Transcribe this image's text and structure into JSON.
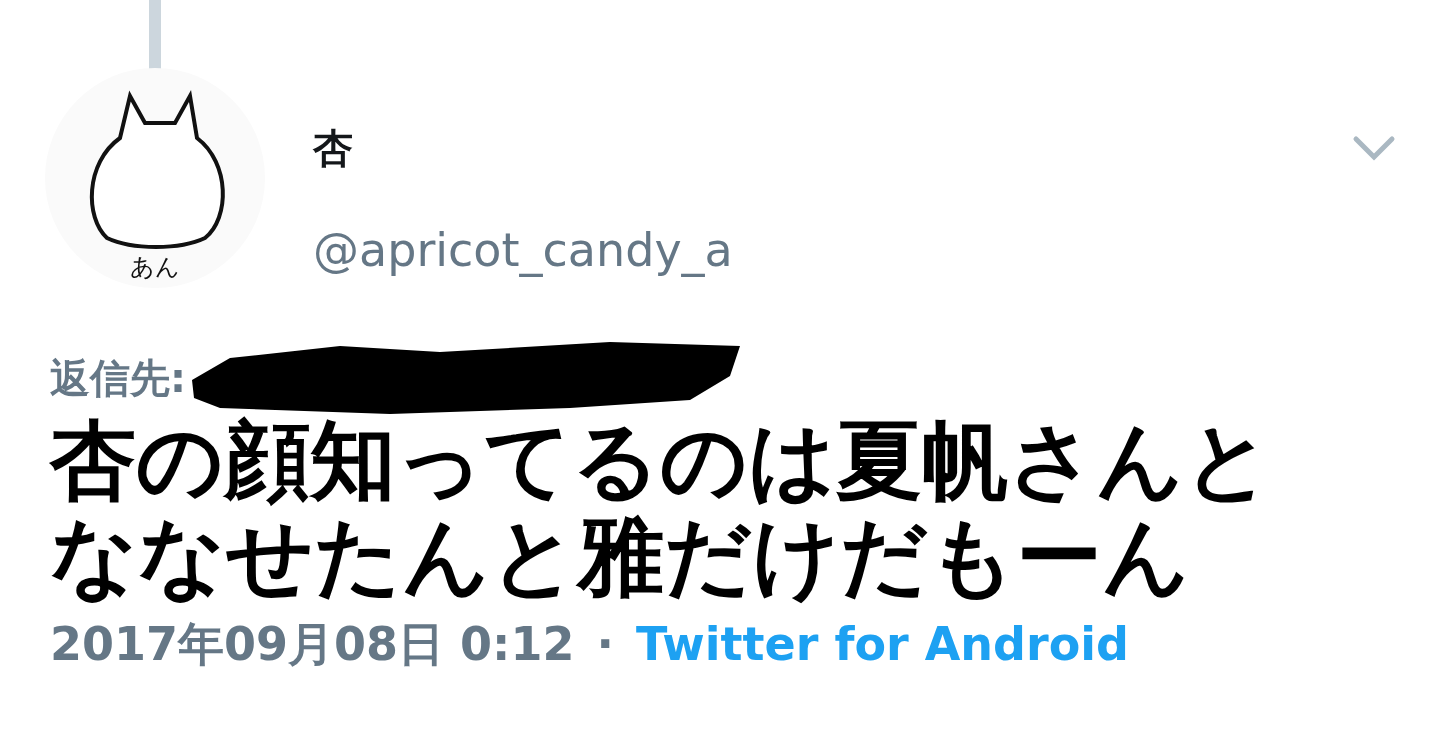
{
  "tweet": {
    "display_name": "杏",
    "handle": "@apricot_candy_a",
    "avatar_caption": "あん",
    "reply_label": "返信先:",
    "reply_redacted": true,
    "text": "杏の顔知ってるのは夏帆さんとななせたんと雅だけだもーん",
    "timestamp": "2017年09月08日 0:12",
    "separator": "·",
    "source": "Twitter for Android"
  }
}
